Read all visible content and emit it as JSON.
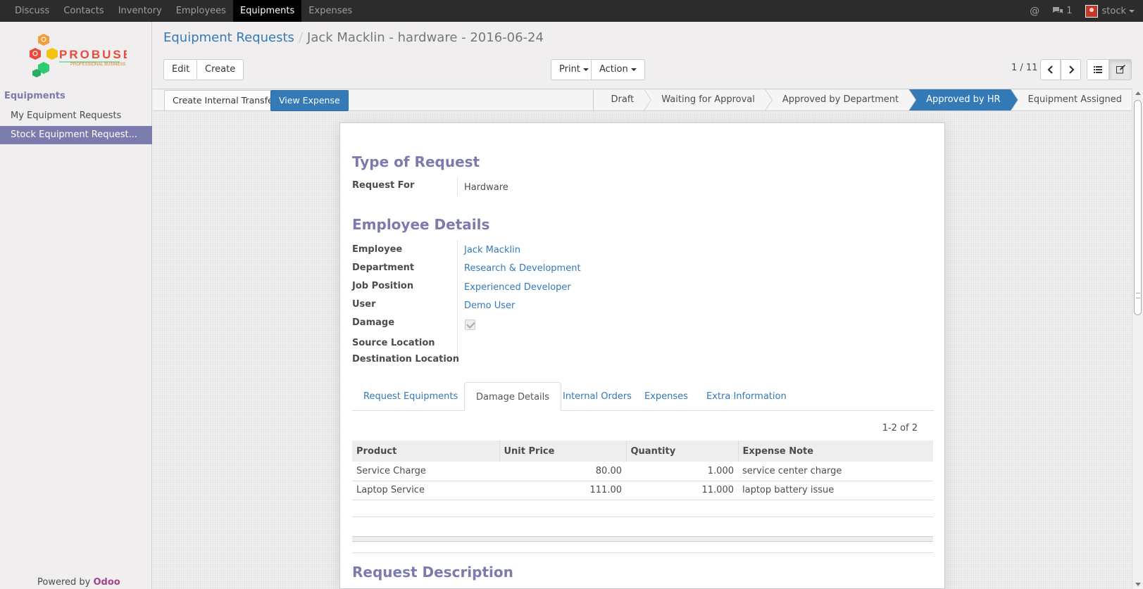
{
  "topbar": {
    "menu": [
      "Discuss",
      "Contacts",
      "Inventory",
      "Employees",
      "Equipments",
      "Expenses"
    ],
    "active_index": 4,
    "messages_count": "1",
    "user": "stock"
  },
  "sidebar": {
    "logo_name": "PROBUSE",
    "logo_tagline": "PROFESSIONAL BUSINESS",
    "section": "Equipments",
    "items": [
      {
        "label": "My Equipment Requests"
      },
      {
        "label": "Stock Equipment Request..."
      }
    ],
    "powered_by": "Powered by",
    "powered_brand": "Odoo"
  },
  "breadcrumb": {
    "parent": "Equipment Requests",
    "separator": "/",
    "current": "Jack Macklin - hardware - 2016-06-24"
  },
  "buttons": {
    "edit": "Edit",
    "create": "Create",
    "print": "Print",
    "action": "Action"
  },
  "pager": {
    "value": "1 / 11"
  },
  "statusbar": {
    "create_transfer": "Create Internal Transfer",
    "view_expense": "View Expense",
    "stages": [
      "Draft",
      "Waiting for Approval",
      "Approved by Department",
      "Approved by HR",
      "Equipment Assigned"
    ],
    "current_stage": "Approved by HR"
  },
  "form": {
    "type_title": "Type of Request",
    "request_for_label": "Request For",
    "request_for_value": "Hardware",
    "employee_title": "Employee Details",
    "employee_label": "Employee",
    "employee_value": "Jack Macklin",
    "department_label": "Department",
    "department_value": "Research & Development",
    "job_label": "Job Position",
    "job_value": "Experienced Developer",
    "user_label": "User",
    "user_value": "Demo User",
    "damage_label": "Damage",
    "damage_checked": true,
    "source_label": "Source Location",
    "destination_label": "Destination Location",
    "tabs": [
      "Request Equipments",
      "Damage Details",
      "Internal Orders",
      "Expenses",
      "Extra Information"
    ],
    "active_tab": "Damage Details",
    "record_count": "1-2 of 2",
    "table": {
      "columns": [
        "Product",
        "Unit Price",
        "Quantity",
        "Expense Note"
      ],
      "rows": [
        [
          "Service Charge",
          "80.00",
          "1.000",
          "service center charge"
        ],
        [
          "Laptop Service",
          "111.00",
          "11.000",
          "laptop battery issue"
        ]
      ]
    },
    "description_title": "Request Description"
  },
  "colors": {
    "accent": "#7c7bad",
    "link": "#337ab7",
    "topbar": "#2c2c2c",
    "odoo": "#a24689"
  }
}
